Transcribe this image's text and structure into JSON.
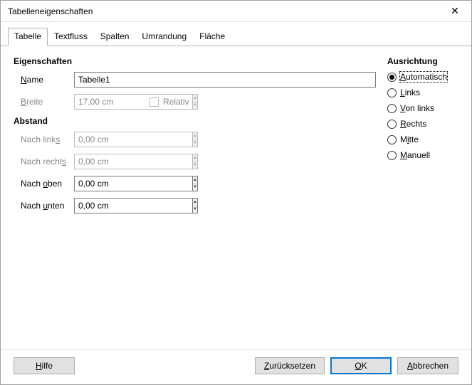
{
  "window": {
    "title": "Tabelleneigenschaften"
  },
  "tabs": [
    {
      "label": "Tabelle"
    },
    {
      "label": "Textfluss"
    },
    {
      "label": "Spalten"
    },
    {
      "label": "Umrandung"
    },
    {
      "label": "Fläche"
    }
  ],
  "properties": {
    "section": "Eigenschaften",
    "name_label": "Name",
    "name_value": "Tabelle1",
    "breite_label": "Breite",
    "breite_value": "17,00 cm",
    "relativ_label": "Relativ"
  },
  "spacing": {
    "section": "Abstand",
    "nach_links_label": "Nach links",
    "nach_links_value": "0,00 cm",
    "nach_rechts_label": "Nach rechts",
    "nach_rechts_value": "0,00 cm",
    "nach_oben_label": "Nach oben",
    "nach_oben_value": "0,00 cm",
    "nach_unten_label": "Nach unten",
    "nach_unten_value": "0,00 cm"
  },
  "align": {
    "section": "Ausrichtung",
    "options": [
      {
        "label": "Automatisch",
        "checked": true
      },
      {
        "label": "Links",
        "checked": false
      },
      {
        "label": "Von links",
        "checked": false
      },
      {
        "label": "Rechts",
        "checked": false
      },
      {
        "label": "Mitte",
        "checked": false
      },
      {
        "label": "Manuell",
        "checked": false
      }
    ]
  },
  "buttons": {
    "help": "Hilfe",
    "reset": "Zurücksetzen",
    "ok": "OK",
    "cancel": "Abbrechen"
  }
}
